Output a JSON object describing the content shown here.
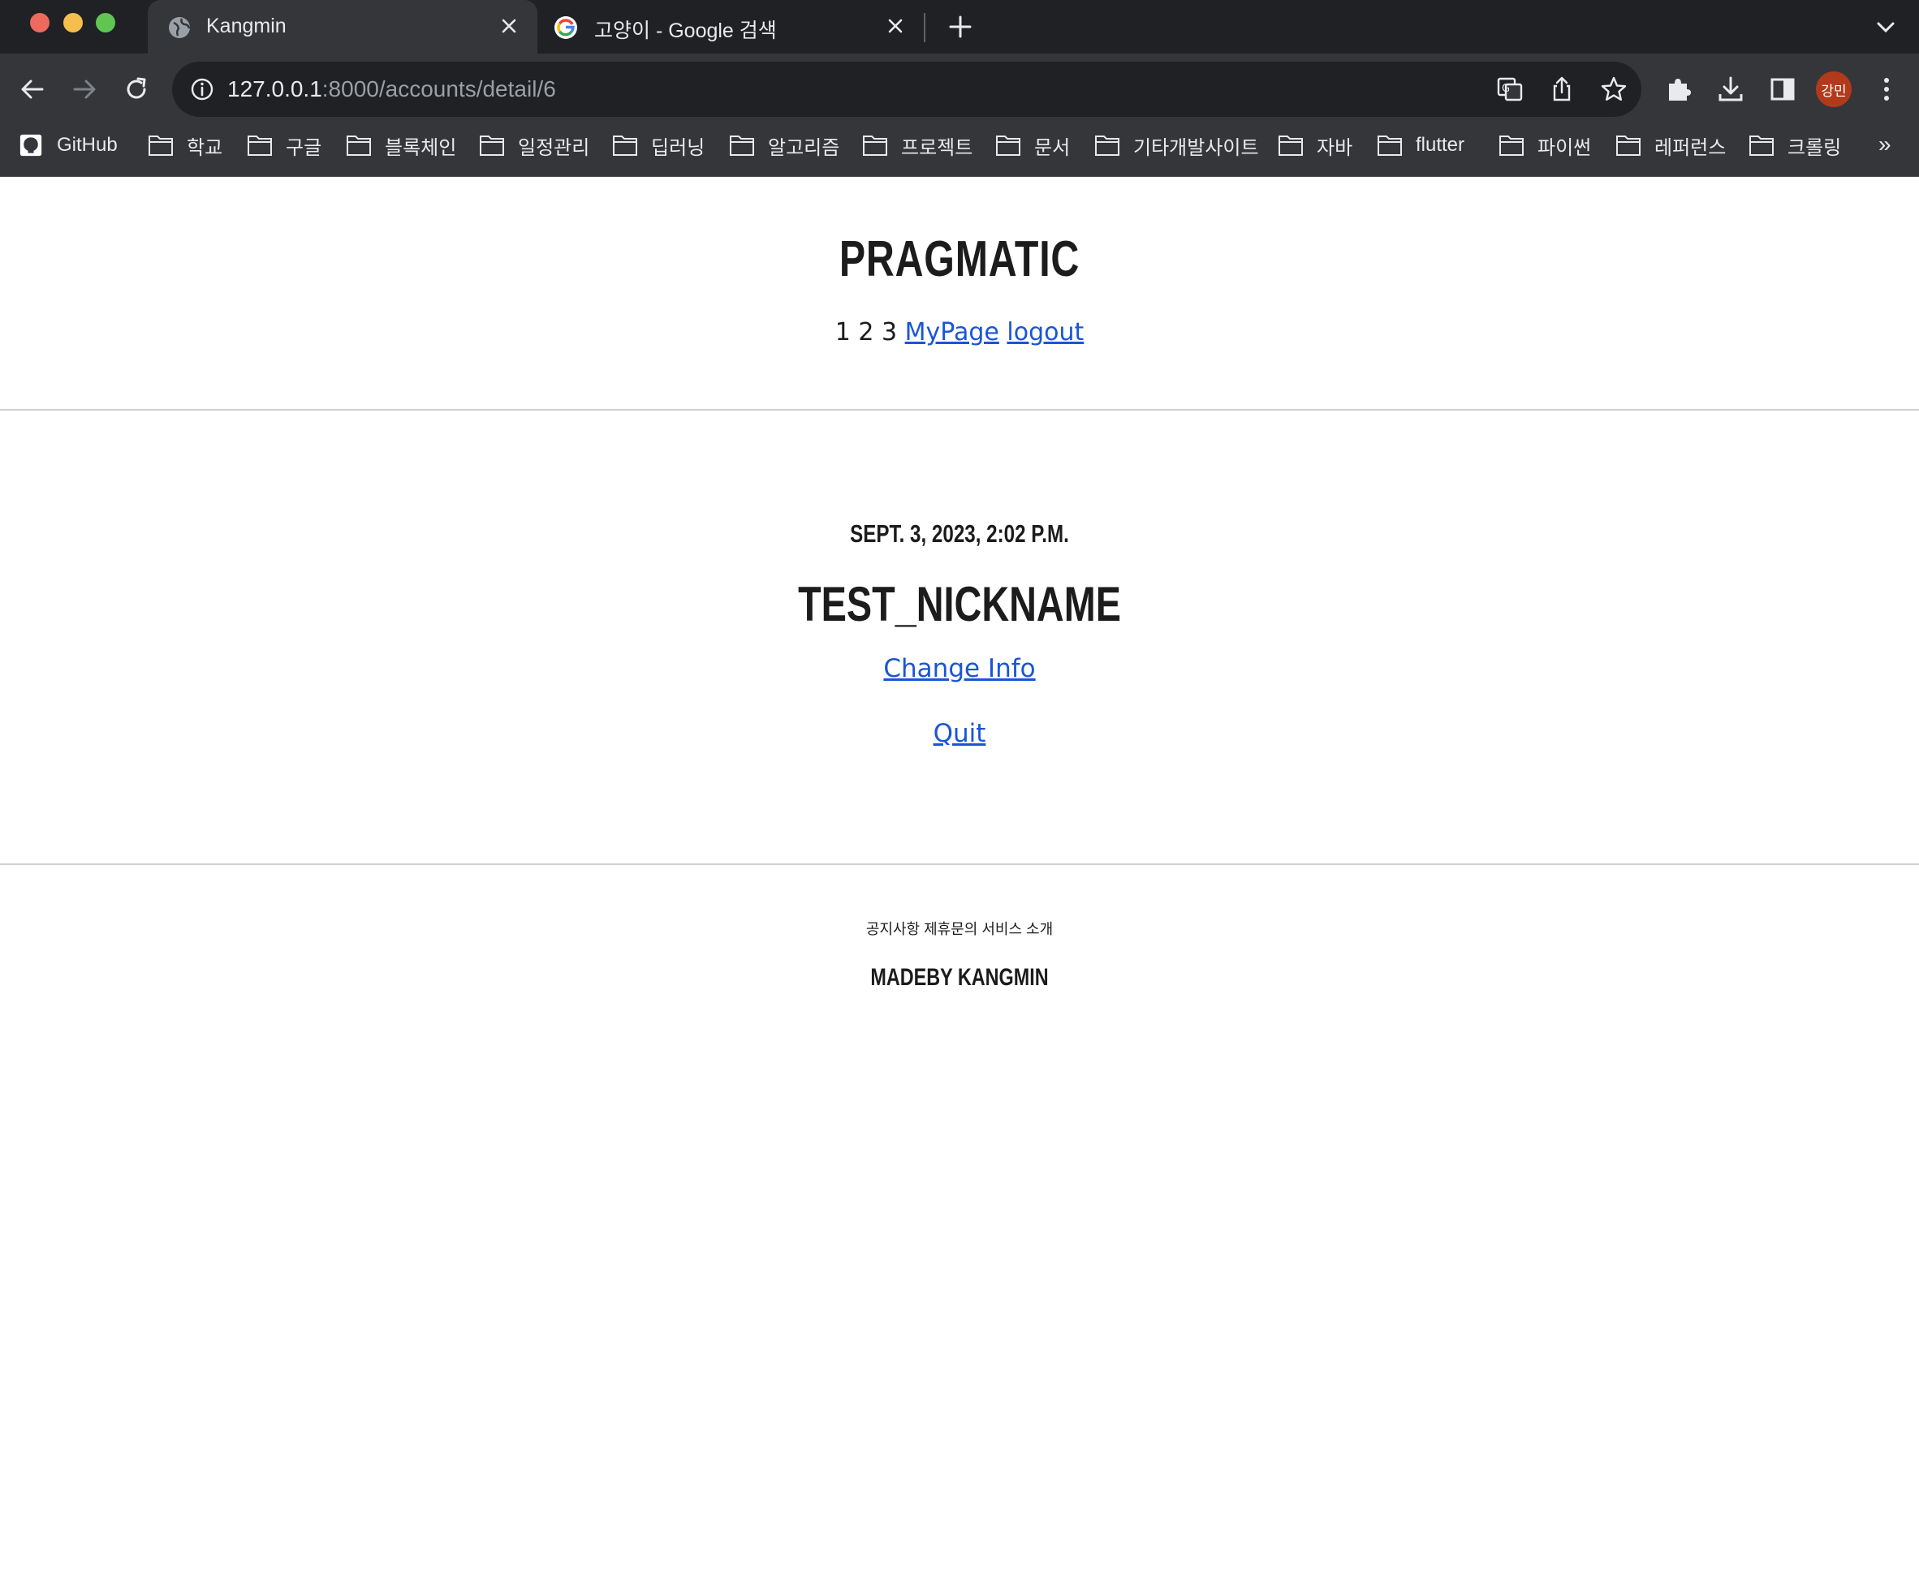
{
  "browser": {
    "tabs": [
      {
        "title": "Kangmin",
        "active": true,
        "icon": "globe-icon"
      },
      {
        "title": "고양이 - Google 검색",
        "active": false,
        "icon": "google-icon"
      }
    ],
    "address": {
      "host": "127.0.0.1",
      "path": ":8000/accounts/detail/6"
    },
    "profile_avatar": "강민",
    "bookmarks": [
      {
        "label": "GitHub",
        "icon": "github-icon"
      },
      {
        "label": "학교",
        "icon": "folder-icon"
      },
      {
        "label": "구글",
        "icon": "folder-icon"
      },
      {
        "label": "블록체인",
        "icon": "folder-icon"
      },
      {
        "label": "일정관리",
        "icon": "folder-icon"
      },
      {
        "label": "딥러닝",
        "icon": "folder-icon"
      },
      {
        "label": "알고리즘",
        "icon": "folder-icon"
      },
      {
        "label": "프로젝트",
        "icon": "folder-icon"
      },
      {
        "label": "문서",
        "icon": "folder-icon"
      },
      {
        "label": "기타개발사이트",
        "icon": "folder-icon"
      },
      {
        "label": "자바",
        "icon": "folder-icon"
      },
      {
        "label": "flutter",
        "icon": "folder-icon"
      },
      {
        "label": "파이썬",
        "icon": "folder-icon"
      },
      {
        "label": "레퍼런스",
        "icon": "folder-icon"
      },
      {
        "label": "크롤링",
        "icon": "folder-icon"
      }
    ],
    "bookmarks_overflow": "»"
  },
  "header": {
    "logo": "PRAGMATIC",
    "nav_plain": "1 2 3 ",
    "nav_mypage": "MyPage",
    "nav_logout": "logout"
  },
  "profile": {
    "date_joined": "SEPT. 3, 2023, 2:02 P.M.",
    "nickname": "TEST_NICKNAME",
    "change_info": "Change Info",
    "quit": "Quit"
  },
  "footer": {
    "links": "공지사항 제휴문의 서비스 소개",
    "madeby": "MADEBY KANGMIN"
  },
  "colors": {
    "link": "#1a55d8",
    "chrome_dark": "#202124",
    "chrome_toolbar": "#35363a",
    "avatar": "#b23a1a"
  }
}
